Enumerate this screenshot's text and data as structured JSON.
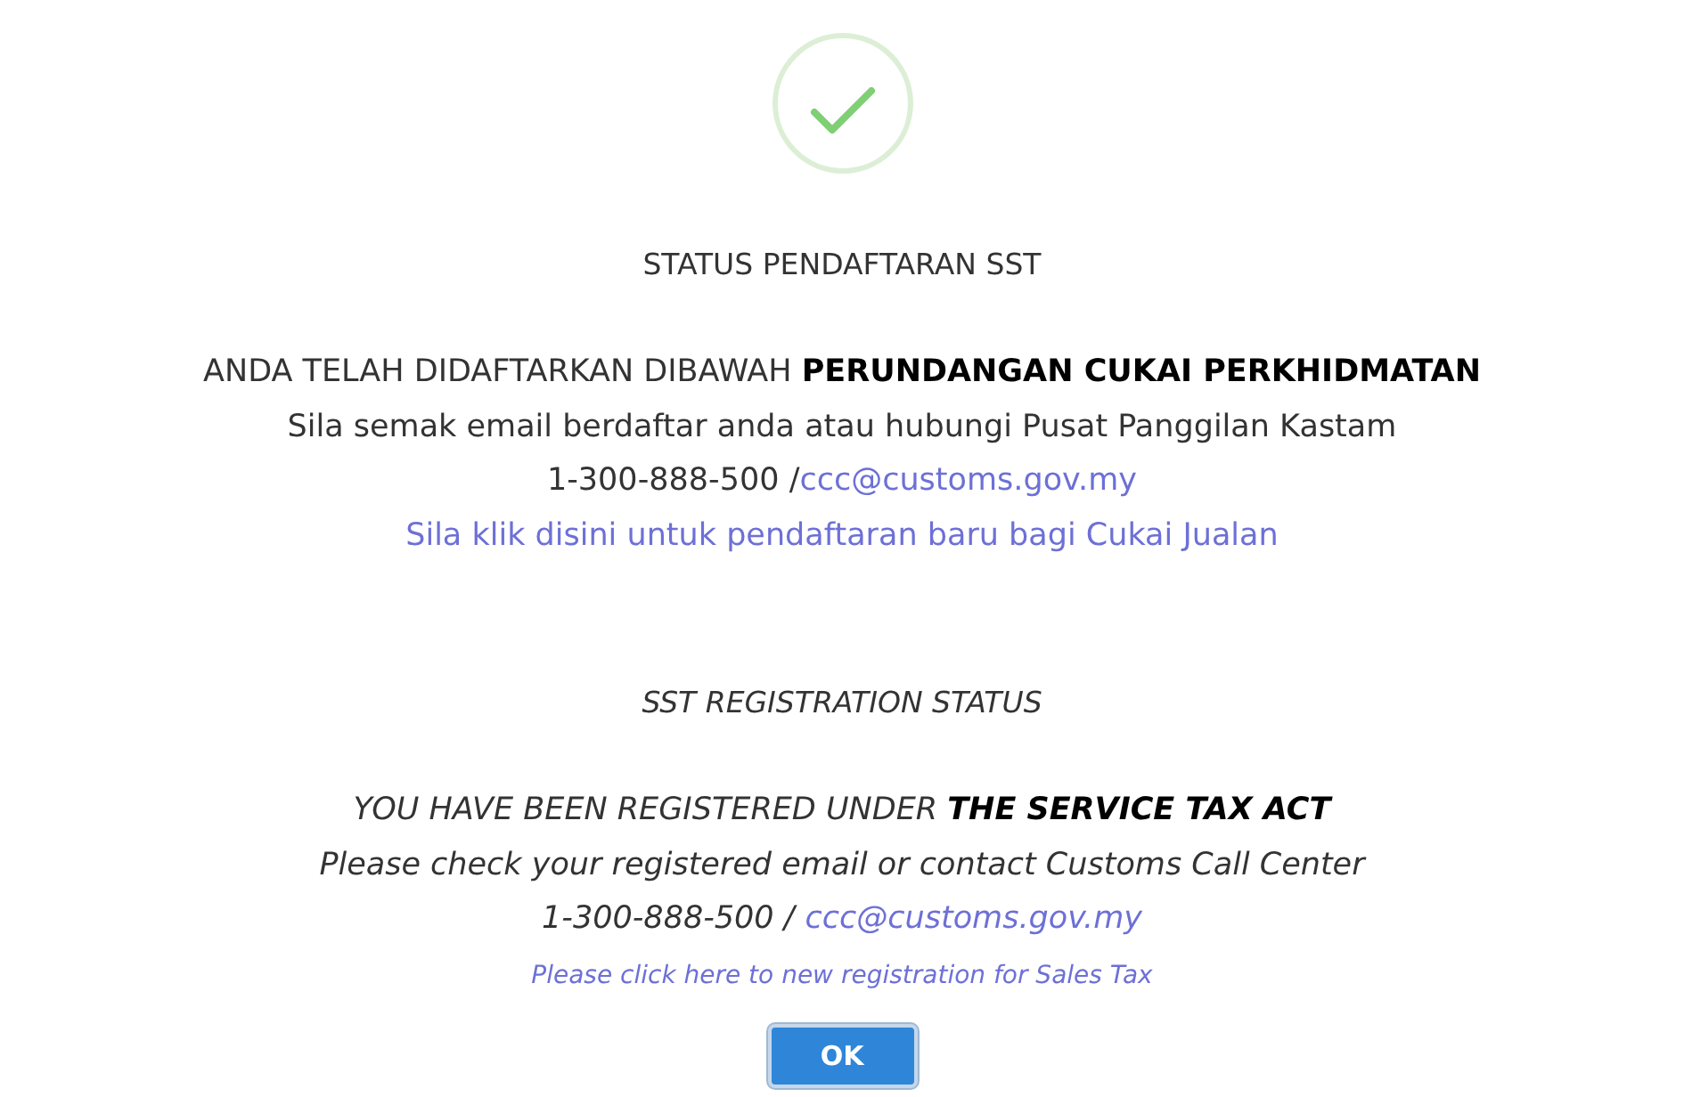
{
  "sections": [
    {
      "kind": "upright",
      "heading": "STATUS PENDAFTARAN SST",
      "statement": "ANDA TELAH DIDAFTARKAN DIBAWAH **PERUNDANGAN CUKAI PERKHIDMATAN**",
      "contact": "Sila semak email berdaftar anda atau hubungi Pusat Panggilan Kastam",
      "phone": "1-300-888-500 /",
      "email": "ccc@customs.gov.my",
      "register_link": "Sila klik disini untuk pendaftaran baru bagi Cukai Jualan"
    },
    {
      "kind": "italic",
      "heading": "SST REGISTRATION STATUS",
      "statement": "YOU HAVE BEEN REGISTERED UNDER **THE SERVICE TAX ACT**",
      "contact": "Please check your registered email or contact Customs Call Center",
      "phone": "1-300-888-500 /",
      "email": "ccc@customs.gov.my",
      "register_link": "Please click here to new registration for Sales Tax"
    }
  ],
  "button": "OK"
}
